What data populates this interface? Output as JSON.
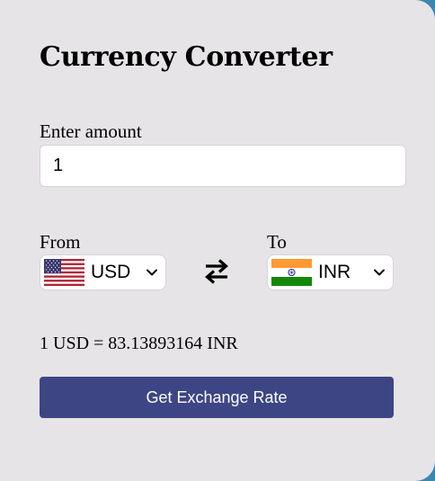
{
  "app": {
    "title": "Currency Converter"
  },
  "amount": {
    "label": "Enter amount",
    "value": "1"
  },
  "from": {
    "label": "From",
    "currency": "USD",
    "flag_icon": "us-flag-icon"
  },
  "to": {
    "label": "To",
    "currency": "INR",
    "flag_icon": "india-flag-icon"
  },
  "swap": {
    "icon": "swap-arrows-icon"
  },
  "result": {
    "text": "1 USD = 83.13893164 INR"
  },
  "action": {
    "button_label": "Get Exchange Rate"
  },
  "colors": {
    "card_background": "#e6e4e6",
    "page_background": "#3d86ad",
    "button_background": "#3d4584",
    "button_text": "#ffffff"
  }
}
